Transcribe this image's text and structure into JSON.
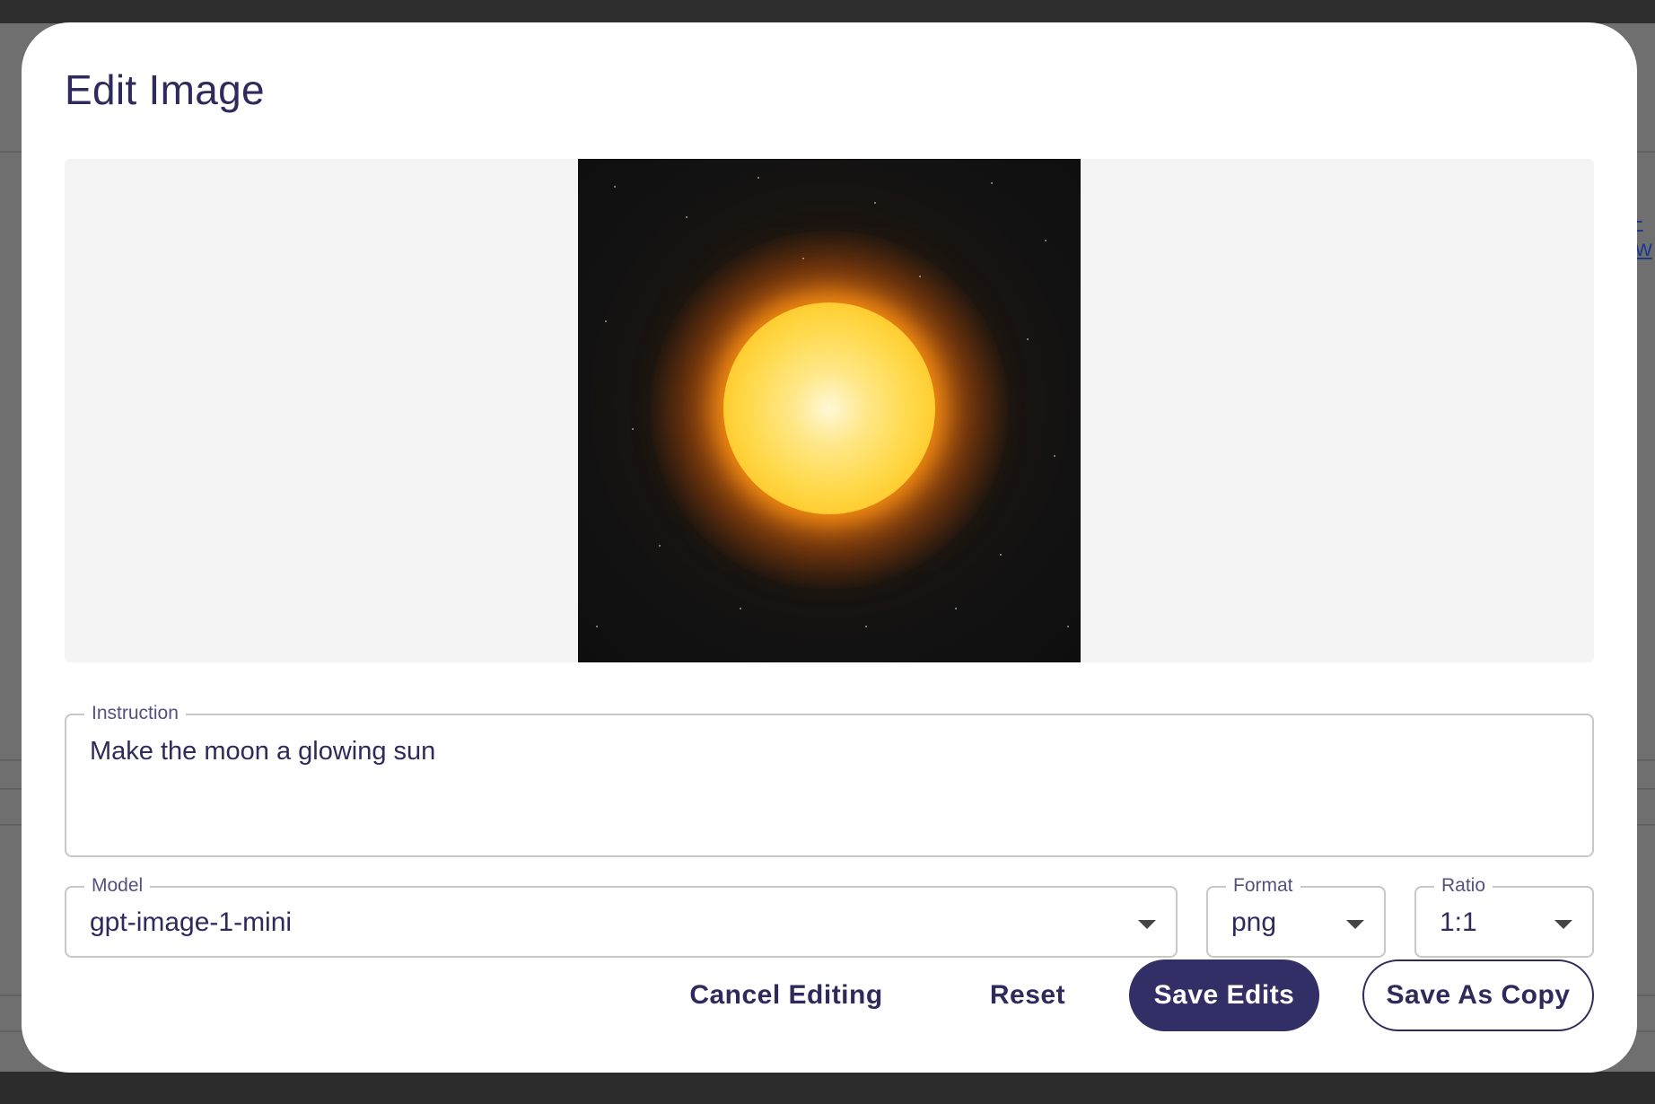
{
  "modal": {
    "title": "Edit Image"
  },
  "instruction": {
    "label": "Instruction",
    "value": "Make the moon a glowing sun"
  },
  "model": {
    "label": "Model",
    "value": "gpt-image-1-mini"
  },
  "format": {
    "label": "Format",
    "value": "png"
  },
  "ratio": {
    "label": "Ratio",
    "value": "1:1"
  },
  "actions": {
    "cancel_label": "Cancel Editing",
    "reset_label": "Reset",
    "save_label": "Save Edits",
    "copy_label": "Save As Copy"
  },
  "background": {
    "link_text": "-w"
  },
  "colors": {
    "primary": "#322e66",
    "text": "#2e2b5c",
    "label": "#55507f",
    "border": "#c7c7c7",
    "preview_bg": "#f4f4f4"
  }
}
